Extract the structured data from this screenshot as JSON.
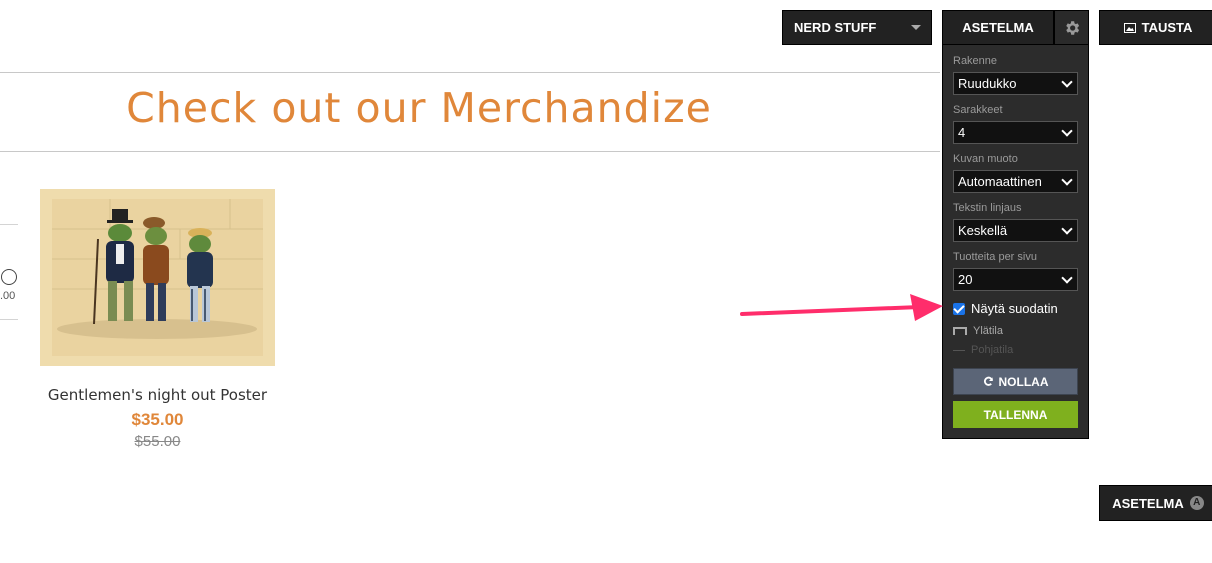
{
  "toolbar": {
    "category_select_value": "NERD STUFF",
    "layout_tab_label": "ASETELMA",
    "gear_icon": "gear-icon",
    "background_button_label": "TAUSTA",
    "background_icon": "image-icon"
  },
  "page": {
    "title": "Check out our Merchandize",
    "filter_price_fragment": ".00"
  },
  "product": {
    "name": "Gentlemen's night out Poster",
    "price": "$35.00",
    "old_price": "$55.00"
  },
  "settings_panel": {
    "structure_label": "Rakenne",
    "structure_value": "Ruudukko",
    "columns_label": "Sarakkeet",
    "columns_value": "4",
    "image_shape_label": "Kuvan muoto",
    "image_shape_value": "Automaattinen",
    "text_align_label": "Tekstin linjaus",
    "text_align_value": "Keskellä",
    "per_page_label": "Tuotteita per sivu",
    "per_page_value": "20",
    "show_filter_label": "Näytä suodatin",
    "show_filter_checked": true,
    "header_option_label": "Ylätila",
    "footer_option_label": "Pohjatila",
    "reset_label": "NOLLAA",
    "save_label": "TALLENNA"
  },
  "bottom_button": {
    "label": "ASETELMA",
    "badge": "A"
  },
  "colors": {
    "accent": "#e0873a",
    "panel_bg": "#2c2c2c",
    "save_green": "#7fb01e",
    "reset_gray": "#5b6577",
    "arrow_pink": "#ff2d6b"
  }
}
